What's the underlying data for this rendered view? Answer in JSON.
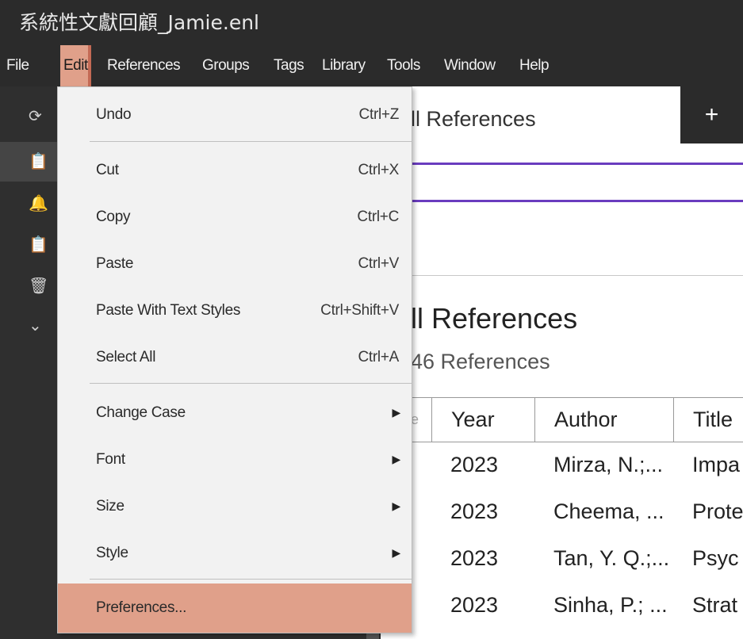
{
  "window": {
    "title": "系統性文獻回顧_Jamie.enl"
  },
  "menubar": {
    "items": [
      "File",
      "Edit",
      "References",
      "Groups",
      "Tags",
      "Library",
      "Tools",
      "Window",
      "Help"
    ],
    "active": "Edit"
  },
  "sidebar": {
    "icons": [
      "sync-icon",
      "clipboard-icon",
      "bell-icon",
      "clipboard-icon",
      "trash-icon",
      "chevron-down-icon"
    ]
  },
  "edit_menu": {
    "items": [
      {
        "label": "Undo",
        "shortcut": "Ctrl+Z"
      },
      {
        "label": "Cut",
        "shortcut": "Ctrl+X"
      },
      {
        "label": "Copy",
        "shortcut": "Ctrl+C"
      },
      {
        "label": "Paste",
        "shortcut": "Ctrl+V"
      },
      {
        "label": "Paste With Text Styles",
        "shortcut": "Ctrl+Shift+V"
      },
      {
        "label": "Select All",
        "shortcut": "Ctrl+A"
      },
      {
        "label": "Change Case",
        "submenu": true
      },
      {
        "label": "Font",
        "submenu": true
      },
      {
        "label": "Size",
        "submenu": true
      },
      {
        "label": "Style",
        "submenu": true
      },
      {
        "label": "Preferences...",
        "highlighted": true
      }
    ]
  },
  "main": {
    "tab_label": "ll References",
    "add_tab": "+",
    "heading": "ll References",
    "count": "46 References",
    "table": {
      "partial_header_glyph": "e",
      "columns": [
        "Year",
        "Author",
        "Title"
      ],
      "rows": [
        {
          "year": "2023",
          "author": "Mirza, N.;...",
          "title": "Impa"
        },
        {
          "year": "2023",
          "author": "Cheema, ...",
          "title": "Prote"
        },
        {
          "year": "2023",
          "author": "Tan, Y. Q.;...",
          "title": "Psyc"
        },
        {
          "year": "2023",
          "author": "Sinha, P.; ...",
          "title": "Strat"
        }
      ]
    }
  },
  "colors": {
    "accent_highlight": "#e0a08a",
    "search_border": "#6a3cbf",
    "dark_bg": "#2b2b2b"
  }
}
